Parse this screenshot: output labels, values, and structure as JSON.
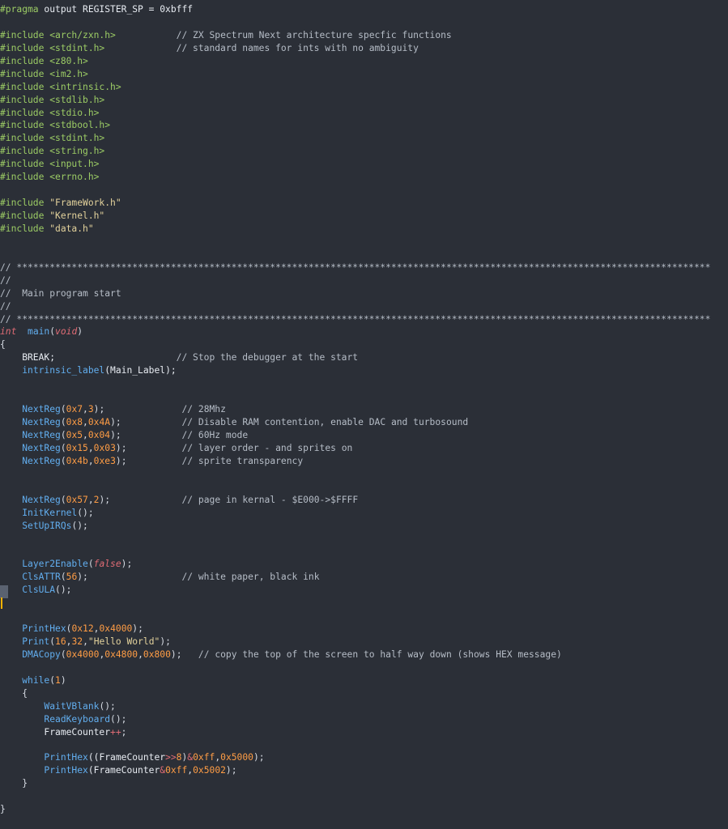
{
  "editor": {
    "theme": {
      "background": "#2b2f37",
      "preprocessor": "#9ccc65",
      "keyword": "#e06c75",
      "function": "#62aeef",
      "number": "#ff9d45",
      "string": "#e3d29c",
      "comment": "#b6bdc7",
      "text": "#d6dbe3",
      "cursor": "#ffb300"
    },
    "cursor_line": 46,
    "lines": [
      [
        {
          "t": "#pragma ",
          "c": "pre"
        },
        {
          "t": "output REGISTER_SP = 0xbfff",
          "c": "plain"
        }
      ],
      [],
      [
        {
          "t": "#include ",
          "c": "pre"
        },
        {
          "t": "<arch/zxn.h>",
          "c": "inc"
        },
        {
          "t": "           // ZX Spectrum Next architecture specfic functions",
          "c": "com"
        }
      ],
      [
        {
          "t": "#include ",
          "c": "pre"
        },
        {
          "t": "<stdint.h>",
          "c": "inc"
        },
        {
          "t": "             // standard names for ints with no ambiguity",
          "c": "com"
        }
      ],
      [
        {
          "t": "#include ",
          "c": "pre"
        },
        {
          "t": "<z80.h>",
          "c": "inc"
        }
      ],
      [
        {
          "t": "#include ",
          "c": "pre"
        },
        {
          "t": "<im2.h>",
          "c": "inc"
        }
      ],
      [
        {
          "t": "#include ",
          "c": "pre"
        },
        {
          "t": "<intrinsic.h>",
          "c": "inc"
        }
      ],
      [
        {
          "t": "#include ",
          "c": "pre"
        },
        {
          "t": "<stdlib.h>",
          "c": "inc"
        }
      ],
      [
        {
          "t": "#include ",
          "c": "pre"
        },
        {
          "t": "<stdio.h>",
          "c": "inc"
        }
      ],
      [
        {
          "t": "#include ",
          "c": "pre"
        },
        {
          "t": "<stdbool.h>",
          "c": "inc"
        }
      ],
      [
        {
          "t": "#include ",
          "c": "pre"
        },
        {
          "t": "<stdint.h>",
          "c": "inc"
        }
      ],
      [
        {
          "t": "#include ",
          "c": "pre"
        },
        {
          "t": "<string.h>",
          "c": "inc"
        }
      ],
      [
        {
          "t": "#include ",
          "c": "pre"
        },
        {
          "t": "<input.h>",
          "c": "inc"
        }
      ],
      [
        {
          "t": "#include ",
          "c": "pre"
        },
        {
          "t": "<errno.h>",
          "c": "inc"
        }
      ],
      [],
      [
        {
          "t": "#include ",
          "c": "pre"
        },
        {
          "t": "\"FrameWork.h\"",
          "c": "str"
        }
      ],
      [
        {
          "t": "#include ",
          "c": "pre"
        },
        {
          "t": "\"Kernel.h\"",
          "c": "str"
        }
      ],
      [
        {
          "t": "#include ",
          "c": "pre"
        },
        {
          "t": "\"data.h\"",
          "c": "str"
        }
      ],
      [],
      [],
      [
        {
          "t": "// ******************************************************************************************************************************",
          "c": "com"
        }
      ],
      [
        {
          "t": "//",
          "c": "com"
        }
      ],
      [
        {
          "t": "//  Main program start",
          "c": "com"
        }
      ],
      [
        {
          "t": "//",
          "c": "com"
        }
      ],
      [
        {
          "t": "// ******************************************************************************************************************************",
          "c": "com"
        }
      ],
      [
        {
          "t": "int",
          "c": "kw"
        },
        {
          "t": "  ",
          "c": "plain"
        },
        {
          "t": "main",
          "c": "fn"
        },
        {
          "t": "(",
          "c": "punc"
        },
        {
          "t": "void",
          "c": "kw"
        },
        {
          "t": ")",
          "c": "punc"
        }
      ],
      [
        {
          "t": "{",
          "c": "punc"
        }
      ],
      [
        {
          "t": "    BREAK;",
          "c": "plain"
        },
        {
          "t": "                      // Stop the debugger at the start",
          "c": "com"
        }
      ],
      [
        {
          "t": "    ",
          "c": "plain"
        },
        {
          "t": "intrinsic_label",
          "c": "fn"
        },
        {
          "t": "(Main_Label);",
          "c": "plain"
        }
      ],
      [],
      [],
      [
        {
          "t": "    ",
          "c": "plain"
        },
        {
          "t": "NextReg",
          "c": "fn"
        },
        {
          "t": "(",
          "c": "punc"
        },
        {
          "t": "0x7",
          "c": "num"
        },
        {
          "t": ",",
          "c": "punc"
        },
        {
          "t": "3",
          "c": "num"
        },
        {
          "t": ");",
          "c": "punc"
        },
        {
          "t": "              // 28Mhz",
          "c": "com"
        }
      ],
      [
        {
          "t": "    ",
          "c": "plain"
        },
        {
          "t": "NextReg",
          "c": "fn"
        },
        {
          "t": "(",
          "c": "punc"
        },
        {
          "t": "0x8",
          "c": "num"
        },
        {
          "t": ",",
          "c": "punc"
        },
        {
          "t": "0x4A",
          "c": "num"
        },
        {
          "t": ");",
          "c": "punc"
        },
        {
          "t": "           // Disable RAM contention, enable DAC and turbosound",
          "c": "com"
        }
      ],
      [
        {
          "t": "    ",
          "c": "plain"
        },
        {
          "t": "NextReg",
          "c": "fn"
        },
        {
          "t": "(",
          "c": "punc"
        },
        {
          "t": "0x5",
          "c": "num"
        },
        {
          "t": ",",
          "c": "punc"
        },
        {
          "t": "0x04",
          "c": "num"
        },
        {
          "t": ");",
          "c": "punc"
        },
        {
          "t": "           // 60Hz mode",
          "c": "com"
        }
      ],
      [
        {
          "t": "    ",
          "c": "plain"
        },
        {
          "t": "NextReg",
          "c": "fn"
        },
        {
          "t": "(",
          "c": "punc"
        },
        {
          "t": "0x15",
          "c": "num"
        },
        {
          "t": ",",
          "c": "punc"
        },
        {
          "t": "0x03",
          "c": "num"
        },
        {
          "t": ");",
          "c": "punc"
        },
        {
          "t": "          // layer order - and sprites on",
          "c": "com"
        }
      ],
      [
        {
          "t": "    ",
          "c": "plain"
        },
        {
          "t": "NextReg",
          "c": "fn"
        },
        {
          "t": "(",
          "c": "punc"
        },
        {
          "t": "0x4b",
          "c": "num"
        },
        {
          "t": ",",
          "c": "punc"
        },
        {
          "t": "0xe3",
          "c": "num"
        },
        {
          "t": ");",
          "c": "punc"
        },
        {
          "t": "          // sprite transparency",
          "c": "com"
        }
      ],
      [],
      [],
      [
        {
          "t": "    ",
          "c": "plain"
        },
        {
          "t": "NextReg",
          "c": "fn"
        },
        {
          "t": "(",
          "c": "punc"
        },
        {
          "t": "0x57",
          "c": "num"
        },
        {
          "t": ",",
          "c": "punc"
        },
        {
          "t": "2",
          "c": "num"
        },
        {
          "t": ");",
          "c": "punc"
        },
        {
          "t": "             // page in kernal - $E000->$FFFF",
          "c": "com"
        }
      ],
      [
        {
          "t": "    ",
          "c": "plain"
        },
        {
          "t": "InitKernel",
          "c": "fn"
        },
        {
          "t": "();",
          "c": "punc"
        }
      ],
      [
        {
          "t": "    ",
          "c": "plain"
        },
        {
          "t": "SetUpIRQs",
          "c": "fn"
        },
        {
          "t": "();",
          "c": "punc"
        }
      ],
      [],
      [],
      [
        {
          "t": "    ",
          "c": "plain"
        },
        {
          "t": "Layer2Enable",
          "c": "fn"
        },
        {
          "t": "(",
          "c": "punc"
        },
        {
          "t": "false",
          "c": "bool"
        },
        {
          "t": ");",
          "c": "punc"
        }
      ],
      [
        {
          "t": "    ",
          "c": "plain"
        },
        {
          "t": "ClsATTR",
          "c": "fn"
        },
        {
          "t": "(",
          "c": "punc"
        },
        {
          "t": "56",
          "c": "num"
        },
        {
          "t": ");",
          "c": "punc"
        },
        {
          "t": "                 // white paper, black ink",
          "c": "com"
        }
      ],
      [
        {
          "t": "    ",
          "c": "plain"
        },
        {
          "t": "ClsULA",
          "c": "fn"
        },
        {
          "t": "();",
          "c": "punc"
        }
      ],
      [],
      [],
      [
        {
          "t": "    ",
          "c": "plain"
        },
        {
          "t": "PrintHex",
          "c": "fn"
        },
        {
          "t": "(",
          "c": "punc"
        },
        {
          "t": "0x12",
          "c": "num"
        },
        {
          "t": ",",
          "c": "punc"
        },
        {
          "t": "0x4000",
          "c": "num"
        },
        {
          "t": ");",
          "c": "punc"
        }
      ],
      [
        {
          "t": "    ",
          "c": "plain"
        },
        {
          "t": "Print",
          "c": "fn"
        },
        {
          "t": "(",
          "c": "punc"
        },
        {
          "t": "16",
          "c": "num"
        },
        {
          "t": ",",
          "c": "punc"
        },
        {
          "t": "32",
          "c": "num"
        },
        {
          "t": ",",
          "c": "punc"
        },
        {
          "t": "\"Hello World\"",
          "c": "str"
        },
        {
          "t": ");",
          "c": "punc"
        }
      ],
      [
        {
          "t": "    ",
          "c": "plain"
        },
        {
          "t": "DMACopy",
          "c": "fn"
        },
        {
          "t": "(",
          "c": "punc"
        },
        {
          "t": "0x4000",
          "c": "num"
        },
        {
          "t": ",",
          "c": "punc"
        },
        {
          "t": "0x4800",
          "c": "num"
        },
        {
          "t": ",",
          "c": "punc"
        },
        {
          "t": "0x800",
          "c": "num"
        },
        {
          "t": ");",
          "c": "punc"
        },
        {
          "t": "   // copy the top of the screen to half way down (shows HEX message)",
          "c": "com"
        }
      ],
      [],
      [
        {
          "t": "    ",
          "c": "plain"
        },
        {
          "t": "while",
          "c": "fn"
        },
        {
          "t": "(",
          "c": "punc"
        },
        {
          "t": "1",
          "c": "num"
        },
        {
          "t": ")",
          "c": "punc"
        }
      ],
      [
        {
          "t": "    {",
          "c": "punc"
        }
      ],
      [
        {
          "t": "        ",
          "c": "plain"
        },
        {
          "t": "WaitVBlank",
          "c": "fn"
        },
        {
          "t": "();",
          "c": "punc"
        }
      ],
      [
        {
          "t": "        ",
          "c": "plain"
        },
        {
          "t": "ReadKeyboard",
          "c": "fn"
        },
        {
          "t": "();",
          "c": "punc"
        }
      ],
      [
        {
          "t": "        FrameCounter",
          "c": "plain"
        },
        {
          "t": "++",
          "c": "op"
        },
        {
          "t": ";",
          "c": "punc"
        }
      ],
      [],
      [
        {
          "t": "        ",
          "c": "plain"
        },
        {
          "t": "PrintHex",
          "c": "fn"
        },
        {
          "t": "((FrameCounter",
          "c": "plain"
        },
        {
          "t": ">>",
          "c": "op"
        },
        {
          "t": "8",
          "c": "num"
        },
        {
          "t": ")",
          "c": "punc"
        },
        {
          "t": "&",
          "c": "op"
        },
        {
          "t": "0xff",
          "c": "num"
        },
        {
          "t": ",",
          "c": "punc"
        },
        {
          "t": "0x5000",
          "c": "num"
        },
        {
          "t": ");",
          "c": "punc"
        }
      ],
      [
        {
          "t": "        ",
          "c": "plain"
        },
        {
          "t": "PrintHex",
          "c": "fn"
        },
        {
          "t": "(FrameCounter",
          "c": "plain"
        },
        {
          "t": "&",
          "c": "op"
        },
        {
          "t": "0xff",
          "c": "num"
        },
        {
          "t": ",",
          "c": "punc"
        },
        {
          "t": "0x5002",
          "c": "num"
        },
        {
          "t": ");",
          "c": "punc"
        }
      ],
      [
        {
          "t": "    }",
          "c": "punc"
        }
      ],
      [],
      [
        {
          "t": "}",
          "c": "punc"
        }
      ]
    ]
  }
}
